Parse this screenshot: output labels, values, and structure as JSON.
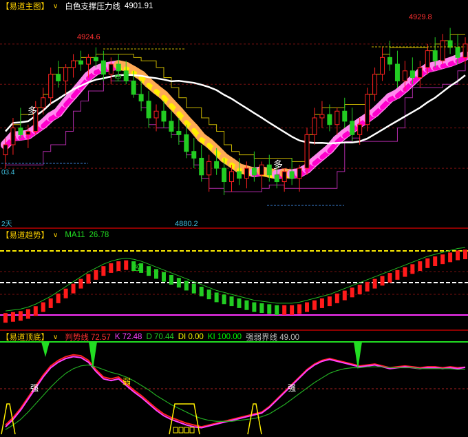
{
  "panels": {
    "main": {
      "name": "【易道主图】",
      "indicator_label": "白色支撑压力线",
      "indicator_value": "4901.91",
      "label_high_left": "4924.6",
      "label_high_right": "4929.8",
      "label_low": "4880.2",
      "label_left_level": "03.4",
      "label_period": "2天",
      "signal_text": "多",
      "signal_text_small": "空"
    },
    "trend": {
      "name": "【易道趋势】",
      "indicator_label": "MA11",
      "indicator_value": "26.78",
      "signal_text": "空"
    },
    "bottom": {
      "name": "【易道顶底】",
      "items": [
        {
          "label": "判势线",
          "value": "72.57",
          "color": "#ff3030"
        },
        {
          "label": "K",
          "value": "72.48",
          "color": "#ff40ff"
        },
        {
          "label": "D",
          "value": "70.44",
          "color": "#22cc22"
        },
        {
          "label": "DI",
          "value": "0.00",
          "color": "#ffff00"
        },
        {
          "label": "KI",
          "value": "100.00",
          "color": "#00ff00"
        },
        {
          "label": "强弱界线",
          "value": "49.00",
          "color": "#c0c0c0"
        }
      ],
      "mark_strong": "强",
      "mark_weak": "弱"
    }
  },
  "chart_data": [
    {
      "type": "candlestick",
      "title": "易道主图",
      "annotations": [
        "4924.6",
        "4929.8",
        "4880.2",
        "03.4"
      ],
      "ohlc": [
        [
          4892,
          4897,
          4888,
          4895
        ],
        [
          4895,
          4903,
          4892,
          4900
        ],
        [
          4900,
          4906,
          4897,
          4898
        ],
        [
          4898,
          4901,
          4894,
          4899
        ],
        [
          4899,
          4908,
          4898,
          4906
        ],
        [
          4906,
          4912,
          4904,
          4909
        ],
        [
          4909,
          4918,
          4907,
          4916
        ],
        [
          4916,
          4920,
          4912,
          4914
        ],
        [
          4914,
          4919,
          4910,
          4918
        ],
        [
          4918,
          4922,
          4915,
          4920
        ],
        [
          4920,
          4923,
          4917,
          4919
        ],
        [
          4919,
          4922,
          4915,
          4921
        ],
        [
          4921,
          4924,
          4918,
          4920
        ],
        [
          4920,
          4923,
          4914,
          4916
        ],
        [
          4916,
          4921,
          4913,
          4919
        ],
        [
          4919,
          4922,
          4915,
          4917
        ],
        [
          4917,
          4920,
          4913,
          4914
        ],
        [
          4914,
          4917,
          4909,
          4910
        ],
        [
          4910,
          4914,
          4905,
          4908
        ],
        [
          4908,
          4911,
          4900,
          4903
        ],
        [
          4903,
          4907,
          4899,
          4905
        ],
        [
          4905,
          4908,
          4900,
          4902
        ],
        [
          4902,
          4905,
          4897,
          4899
        ],
        [
          4899,
          4903,
          4895,
          4898
        ],
        [
          4898,
          4901,
          4891,
          4893
        ],
        [
          4893,
          4897,
          4888,
          4891
        ],
        [
          4891,
          4895,
          4884,
          4886
        ],
        [
          4886,
          4892,
          4881,
          4890
        ],
        [
          4890,
          4894,
          4886,
          4888
        ],
        [
          4888,
          4891,
          4880,
          4884
        ],
        [
          4884,
          4889,
          4881,
          4887
        ],
        [
          4887,
          4891,
          4883,
          4885
        ],
        [
          4885,
          4890,
          4882,
          4888
        ],
        [
          4888,
          4893,
          4884,
          4886
        ],
        [
          4886,
          4890,
          4882,
          4889
        ],
        [
          4889,
          4892,
          4884,
          4886
        ],
        [
          4886,
          4889,
          4882,
          4884
        ],
        [
          4884,
          4888,
          4881,
          4887
        ],
        [
          4887,
          4891,
          4883,
          4885
        ],
        [
          4885,
          4889,
          4881,
          4888
        ],
        [
          4888,
          4900,
          4886,
          4898
        ],
        [
          4898,
          4906,
          4895,
          4903
        ],
        [
          4903,
          4908,
          4900,
          4904
        ],
        [
          4904,
          4907,
          4899,
          4901
        ],
        [
          4901,
          4906,
          4898,
          4905
        ],
        [
          4905,
          4909,
          4900,
          4902
        ],
        [
          4902,
          4906,
          4896,
          4898
        ],
        [
          4898,
          4903,
          4895,
          4901
        ],
        [
          4901,
          4912,
          4899,
          4910
        ],
        [
          4910,
          4918,
          4908,
          4916
        ],
        [
          4916,
          4924,
          4914,
          4921
        ],
        [
          4921,
          4926,
          4917,
          4919
        ],
        [
          4919,
          4923,
          4912,
          4914
        ],
        [
          4914,
          4920,
          4911,
          4917
        ],
        [
          4917,
          4921,
          4913,
          4915
        ],
        [
          4915,
          4920,
          4912,
          4918
        ],
        [
          4918,
          4925,
          4916,
          4923
        ],
        [
          4923,
          4927,
          4918,
          4920
        ],
        [
          4920,
          4928,
          4919,
          4926
        ],
        [
          4926,
          4929.8,
          4922,
          4924
        ],
        [
          4924,
          4928,
          4919,
          4921
        ],
        [
          4921,
          4927,
          4919,
          4925
        ]
      ],
      "ylim": [
        4872,
        4934
      ]
    },
    {
      "type": "bar",
      "title": "易道趋势",
      "series": [
        {
          "name": "MA11",
          "values": [
            2,
            3,
            4,
            6,
            9,
            13,
            17,
            22,
            27,
            32,
            37,
            42,
            46,
            50,
            53,
            55,
            56,
            55,
            53,
            50,
            47,
            44,
            41,
            38,
            35,
            32,
            29,
            26,
            23,
            21,
            19,
            17,
            15,
            13,
            12,
            11,
            10,
            10,
            10,
            11,
            13,
            15,
            17,
            19,
            22,
            25,
            28,
            31,
            34,
            37,
            40,
            43,
            46,
            49,
            52,
            55,
            58,
            60,
            62,
            64,
            66,
            67
          ]
        }
      ],
      "ylim": [
        0,
        72
      ]
    },
    {
      "type": "line",
      "title": "易道顶底",
      "series": [
        {
          "name": "判势线",
          "values": [
            10,
            18,
            28,
            40,
            52,
            64,
            74,
            80,
            84,
            86,
            85,
            80,
            70,
            62,
            60,
            62,
            55,
            48,
            42,
            35,
            28,
            22,
            18,
            15,
            12,
            10,
            8,
            10,
            12,
            14,
            16,
            18,
            20,
            22,
            24,
            30,
            38,
            46,
            54,
            62,
            70,
            76,
            80,
            82,
            80,
            78,
            76,
            74,
            75,
            76,
            74,
            72,
            73,
            74,
            73,
            72,
            73,
            73,
            72,
            73,
            72,
            72.57
          ]
        },
        {
          "name": "K",
          "values": [
            8,
            16,
            26,
            38,
            50,
            62,
            72,
            78,
            82,
            84,
            83,
            78,
            68,
            60,
            58,
            60,
            53,
            46,
            40,
            33,
            26,
            20,
            16,
            13,
            10,
            8,
            7,
            9,
            11,
            13,
            15,
            17,
            19,
            21,
            23,
            29,
            37,
            45,
            53,
            61,
            69,
            75,
            79,
            81,
            79,
            77,
            75,
            73,
            74,
            75,
            73,
            71,
            72,
            73,
            72,
            71,
            72,
            72,
            71,
            72,
            71,
            72.48
          ]
        },
        {
          "name": "D",
          "values": [
            5,
            10,
            16,
            24,
            33,
            42,
            51,
            59,
            66,
            71,
            74,
            75,
            73,
            70,
            67,
            65,
            62,
            58,
            53,
            48,
            42,
            37,
            32,
            28,
            24,
            20,
            17,
            15,
            14,
            14,
            14,
            15,
            16,
            17,
            19,
            22,
            27,
            32,
            38,
            44,
            50,
            56,
            61,
            66,
            69,
            71,
            72,
            72,
            73,
            73,
            73,
            72,
            72,
            72,
            72,
            71,
            71,
            71,
            71,
            71,
            70,
            70.44
          ]
        }
      ],
      "ylim": [
        0,
        100
      ]
    }
  ]
}
